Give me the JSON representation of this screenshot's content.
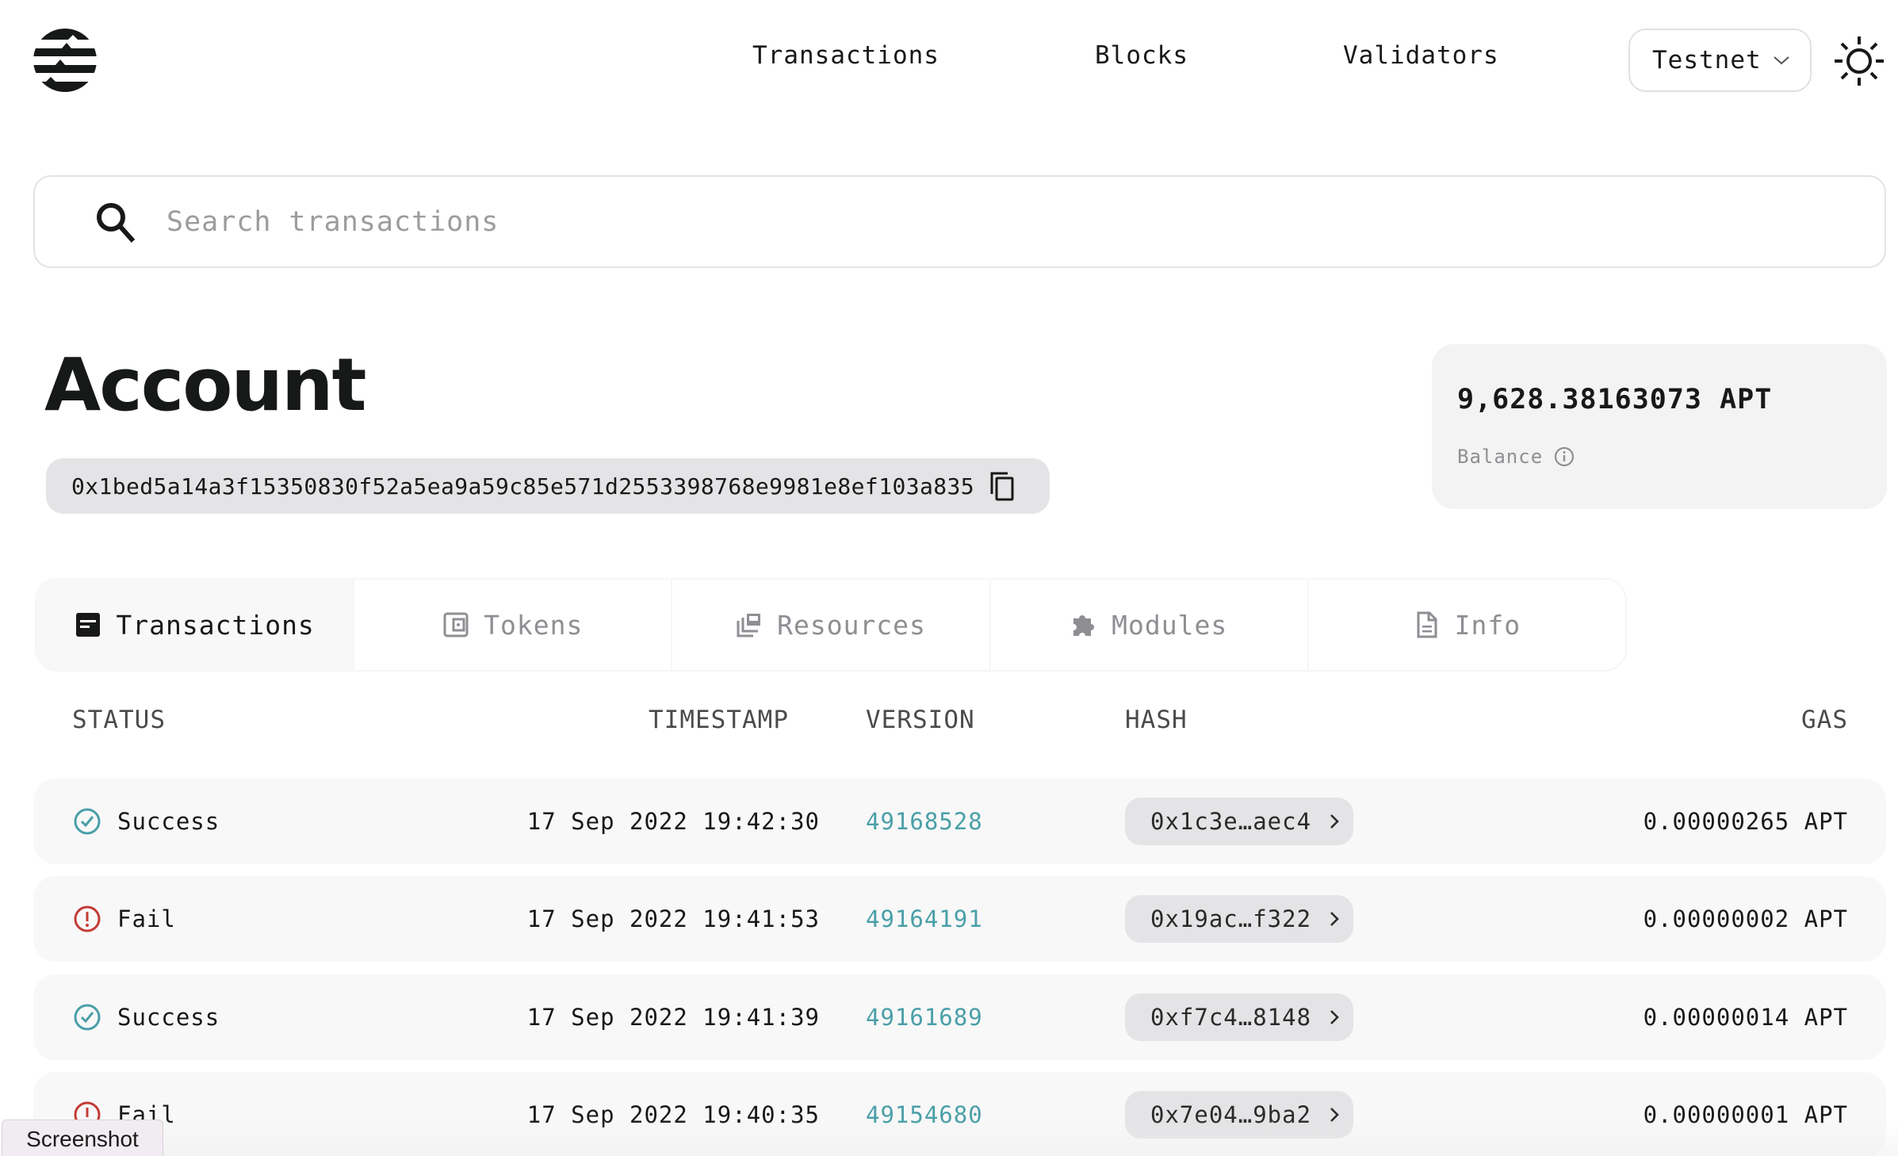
{
  "header": {
    "logo": "aptos-logo-icon",
    "nav": [
      "Transactions",
      "Blocks",
      "Validators"
    ],
    "network": "Testnet",
    "theme_toggle": "sun-icon"
  },
  "search": {
    "placeholder": "Search transactions",
    "value": ""
  },
  "account": {
    "title": "Account",
    "address": "0x1bed5a14a3f15350830f52a5ea9a59c85e571d2553398768e9981e8ef103a835"
  },
  "balance": {
    "value": "9,628.38163073 APT",
    "label": "Balance"
  },
  "tabs": [
    {
      "label": "Transactions",
      "icon": "receipt-icon",
      "active": true
    },
    {
      "label": "Tokens",
      "icon": "wallet-icon",
      "active": false
    },
    {
      "label": "Resources",
      "icon": "collections-icon",
      "active": false
    },
    {
      "label": "Modules",
      "icon": "puzzle-icon",
      "active": false
    },
    {
      "label": "Info",
      "icon": "document-icon",
      "active": false
    }
  ],
  "table": {
    "columns": [
      "STATUS",
      "TIMESTAMP",
      "VERSION",
      "HASH",
      "GAS"
    ],
    "rows": [
      {
        "status": "Success",
        "timestamp": "17 Sep 2022 19:42:30",
        "version": "49168528",
        "hash": "0x1c3e…aec4",
        "gas": "0.00000265 APT"
      },
      {
        "status": "Fail",
        "timestamp": "17 Sep 2022 19:41:53",
        "version": "49164191",
        "hash": "0x19ac…f322",
        "gas": "0.00000002 APT"
      },
      {
        "status": "Success",
        "timestamp": "17 Sep 2022 19:41:39",
        "version": "49161689",
        "hash": "0xf7c4…8148",
        "gas": "0.00000014 APT"
      },
      {
        "status": "Fail",
        "timestamp": "17 Sep 2022 19:40:35",
        "version": "49154680",
        "hash": "0x7e04…9ba2",
        "gas": "0.00000001 APT"
      }
    ]
  },
  "colors": {
    "success": "#4a9fa8",
    "fail": "#c33b36",
    "link": "#4a9fa8"
  },
  "overlay": {
    "screenshot_label": "Screenshot"
  }
}
